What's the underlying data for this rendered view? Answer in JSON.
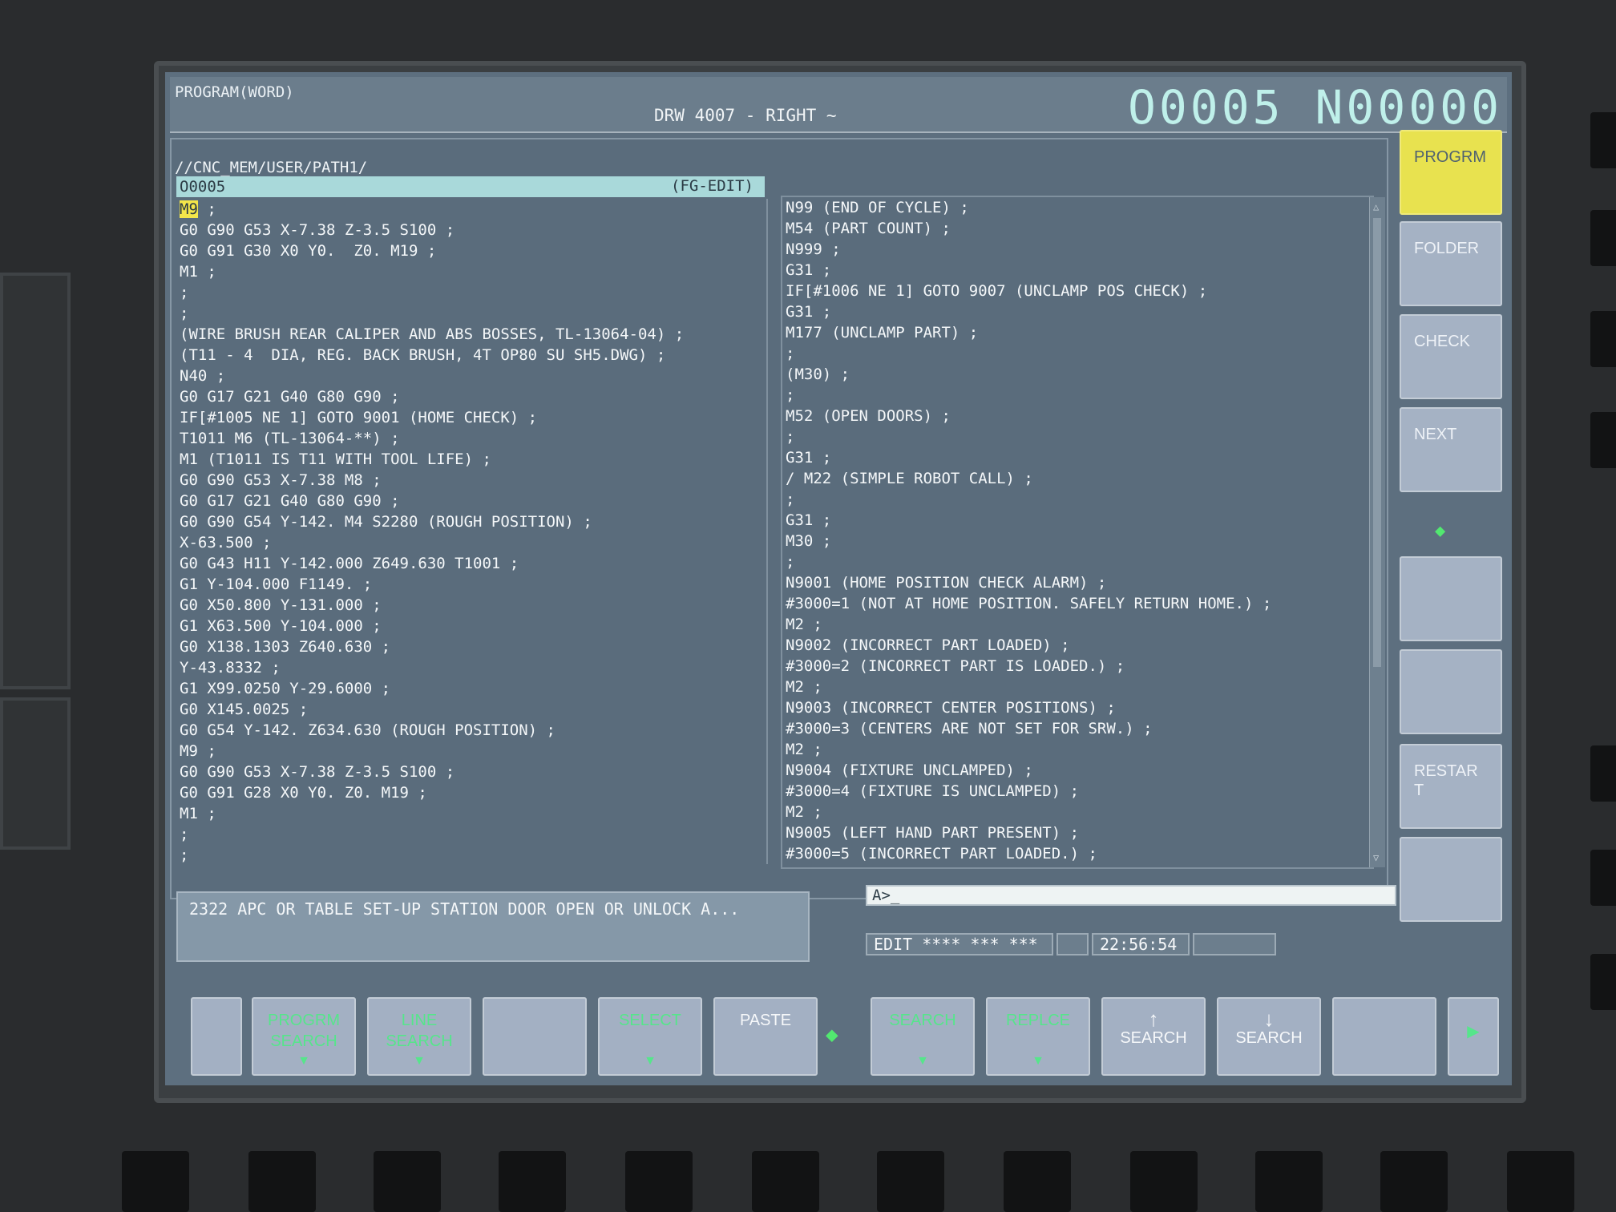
{
  "header": {
    "mode": "PROGRAM(WORD)",
    "title": "DRW 4007 - RIGHT ~",
    "program_number": "O0005 N00000"
  },
  "editor": {
    "path": "//CNC_MEM/USER/PATH1/",
    "file_name": "O0005",
    "edit_mode": "(FG-EDIT)",
    "cursor_word": "M9",
    "left_lines": [
      " ;",
      "G0 G90 G53 X-7.38 Z-3.5 S100 ;",
      "G0 G91 G30 X0 Y0.  Z0. M19 ;",
      "M1 ;",
      ";",
      ";",
      "(WIRE BRUSH REAR CALIPER AND ABS BOSSES, TL-13064-04) ;",
      "(T11 - 4  DIA, REG. BACK BRUSH, 4T OP80 SU SH5.DWG) ;",
      "N40 ;",
      "G0 G17 G21 G40 G80 G90 ;",
      "IF[#1005 NE 1] GOTO 9001 (HOME CHECK) ;",
      "T1011 M6 (TL-13064-**) ;",
      "M1 (T1011 IS T11 WITH TOOL LIFE) ;",
      "G0 G90 G53 X-7.38 M8 ;",
      "G0 G17 G21 G40 G80 G90 ;",
      "G0 G90 G54 Y-142. M4 S2280 (ROUGH POSITION) ;",
      "X-63.500 ;",
      "G0 G43 H11 Y-142.000 Z649.630 T1001 ;",
      "G1 Y-104.000 F1149. ;",
      "G0 X50.800 Y-131.000 ;",
      "G1 X63.500 Y-104.000 ;",
      "G0 X138.1303 Z640.630 ;",
      "Y-43.8332 ;",
      "G1 X99.0250 Y-29.6000 ;",
      "G0 X145.0025 ;",
      "G0 G54 Y-142. Z634.630 (ROUGH POSITION) ;",
      "M9 ;",
      "G0 G90 G53 X-7.38 Z-3.5 S100 ;",
      "G0 G91 G28 X0 Y0. Z0. M19 ;",
      "M1 ;",
      ";",
      ";"
    ],
    "right_lines": [
      "N99 (END OF CYCLE) ;",
      "M54 (PART COUNT) ;",
      "N999 ;",
      "G31 ;",
      "IF[#1006 NE 1] GOTO 9007 (UNCLAMP POS CHECK) ;",
      "G31 ;",
      "M177 (UNCLAMP PART) ;",
      ";",
      "(M30) ;",
      ";",
      "M52 (OPEN DOORS) ;",
      ";",
      "G31 ;",
      "/ M22 (SIMPLE ROBOT CALL) ;",
      ";",
      "G31 ;",
      "M30 ;",
      ";",
      "N9001 (HOME POSITION CHECK ALARM) ;",
      "#3000=1 (NOT AT HOME POSITION. SAFELY RETURN HOME.) ;",
      "M2 ;",
      "N9002 (INCORRECT PART LOADED) ;",
      "#3000=2 (INCORRECT PART IS LOADED.) ;",
      "M2 ;",
      "N9003 (INCORRECT CENTER POSITIONS) ;",
      "#3000=3 (CENTERS ARE NOT SET FOR SRW.) ;",
      "M2 ;",
      "N9004 (FIXTURE UNCLAMPED) ;",
      "#3000=4 (FIXTURE IS UNCLAMPED) ;",
      "M2 ;",
      "N9005 (LEFT HAND PART PRESENT) ;",
      "#3000=5 (INCORRECT PART LOADED.) ;"
    ]
  },
  "message": "2322  APC OR TABLE SET-UP STATION DOOR OPEN OR UNLOCK A...",
  "input_prompt": "A>_",
  "status": {
    "mode": "EDIT **** *** ***",
    "time": "22:56:54"
  },
  "side_keys": [
    {
      "label": "PROGRM"
    },
    {
      "label": "FOLDER"
    },
    {
      "label": "CHECK"
    },
    {
      "label": "NEXT"
    },
    {
      "label": ""
    },
    {
      "label": ""
    },
    {
      "label": "RESTAR\nT"
    },
    {
      "label": ""
    }
  ],
  "soft_keys": [
    {
      "label": ""
    },
    {
      "label": "PROGRM\nSEARCH"
    },
    {
      "label": "LINE\nSEARCH"
    },
    {
      "label": ""
    },
    {
      "label": "SELECT"
    },
    {
      "label": "PASTE"
    },
    {
      "label": "SEARCH"
    },
    {
      "label": "REPLCE"
    },
    {
      "label": "SEARCH"
    },
    {
      "label": "SEARCH"
    },
    {
      "label": ""
    }
  ],
  "colors": {
    "screen_bg": "#5d6f7f",
    "cursor": "#f4e64a",
    "active_key": "#e8e24f",
    "softkey_green": "#56e58b"
  },
  "icons": {
    "continue_right": "triangle-right-icon",
    "softkey_separator": "diamond-chevron-icon"
  }
}
